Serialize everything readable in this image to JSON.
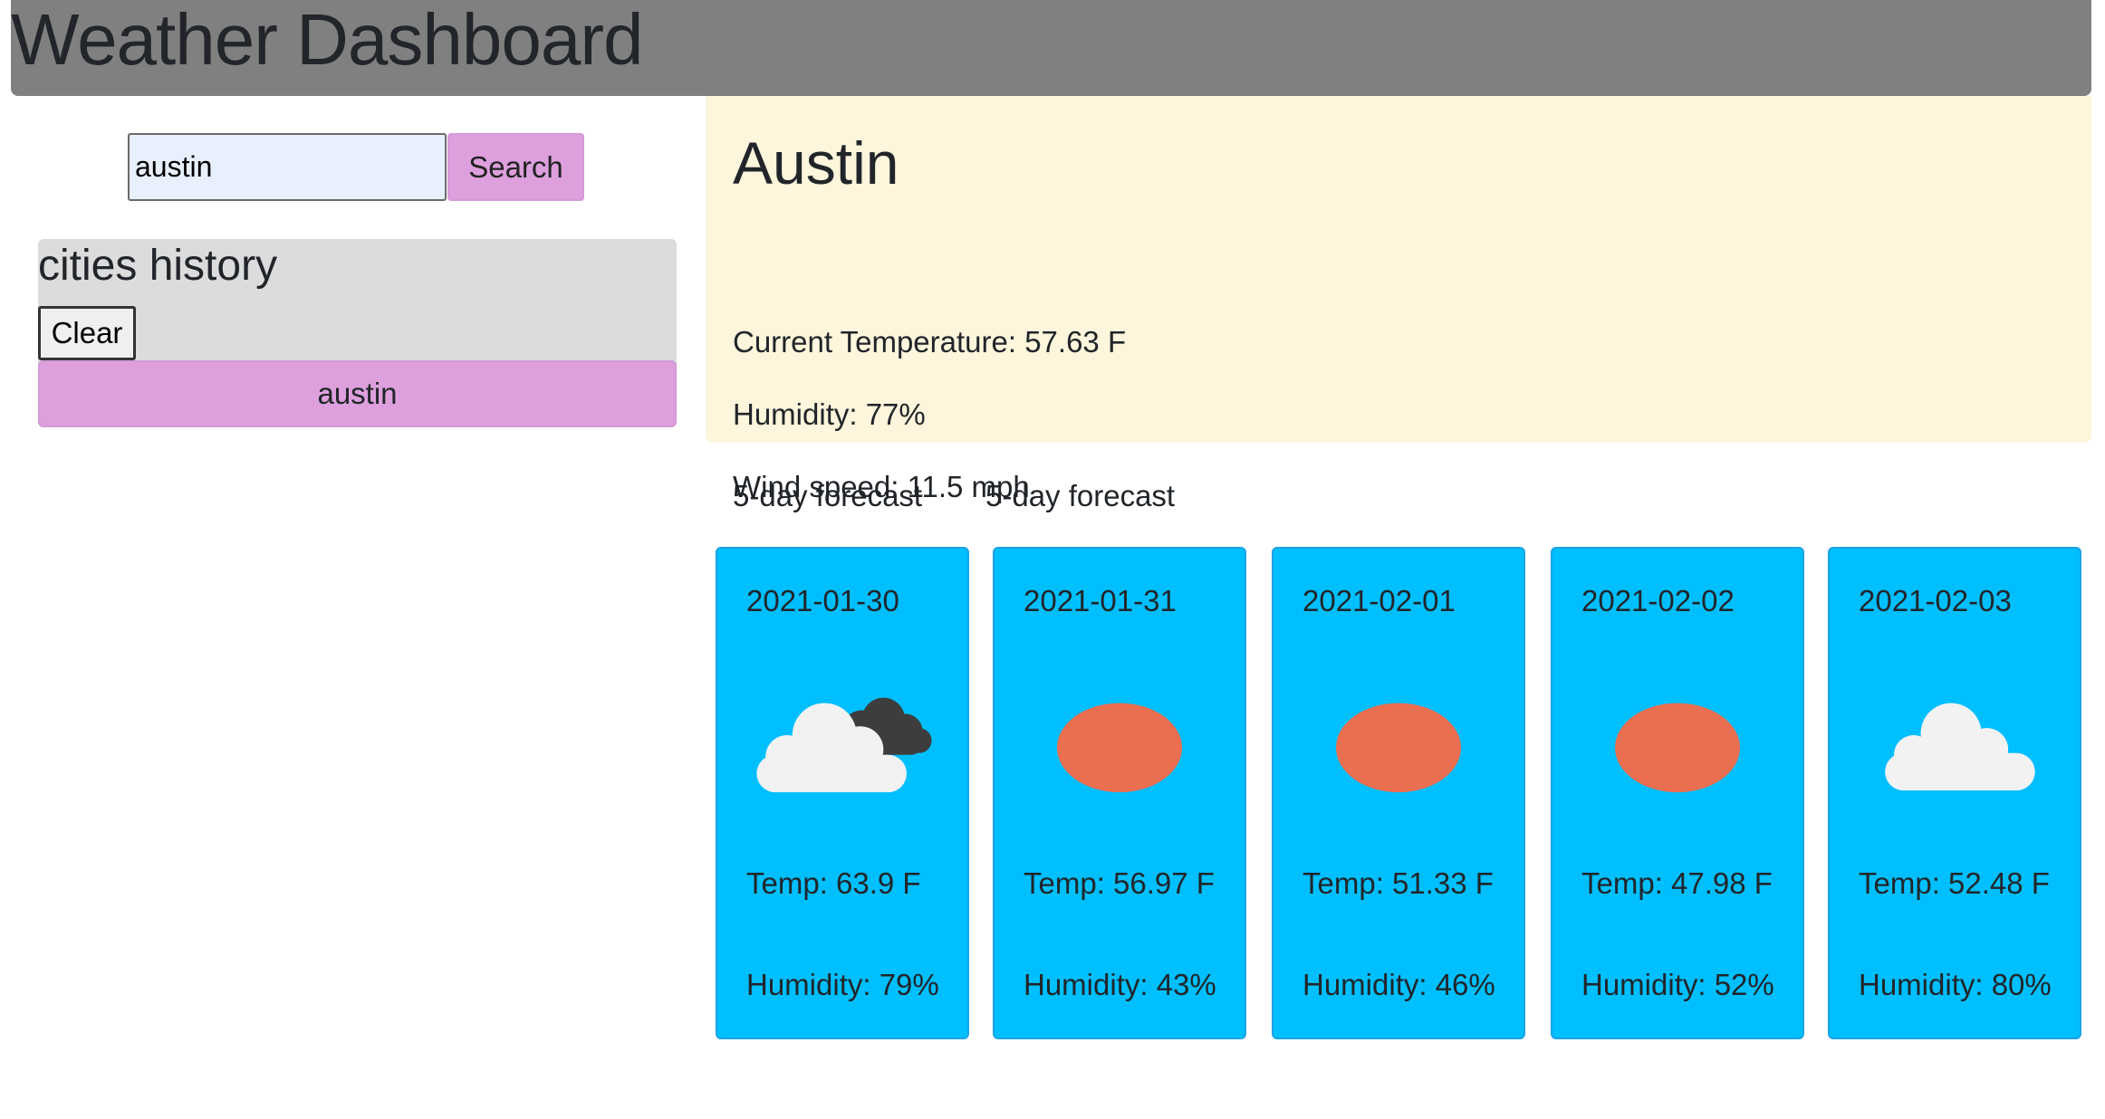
{
  "header": {
    "title": "Weather Dashboard"
  },
  "search": {
    "value": "austin",
    "button_label": "Search"
  },
  "history": {
    "title": "cities history",
    "clear_label": "Clear",
    "items": [
      {
        "label": "austin"
      }
    ]
  },
  "current": {
    "city": "Austin",
    "temperature": "Current Temperature: 57.63 F",
    "humidity": "Humidity: 77%",
    "wind": "Wind speed: 11.5 mph"
  },
  "forecast": {
    "headings": [
      "5-day forecast",
      "5-day forecast"
    ],
    "days": [
      {
        "date": "2021-01-30",
        "icon": "partly-cloudy-icon",
        "temp": "Temp: 63.9 F",
        "humidity": "Humidity: 79%"
      },
      {
        "date": "2021-01-31",
        "icon": "sun-icon",
        "temp": "Temp: 56.97 F",
        "humidity": "Humidity: 43%"
      },
      {
        "date": "2021-02-01",
        "icon": "sun-icon",
        "temp": "Temp: 51.33 F",
        "humidity": "Humidity: 46%"
      },
      {
        "date": "2021-02-02",
        "icon": "sun-icon",
        "temp": "Temp: 47.98 F",
        "humidity": "Humidity: 52%"
      },
      {
        "date": "2021-02-03",
        "icon": "cloud-icon",
        "temp": "Temp: 52.48 F",
        "humidity": "Humidity: 80%"
      }
    ]
  },
  "colors": {
    "header_bg": "#808080",
    "accent_purple": "#dda0dd",
    "current_bg": "#fdf5dc",
    "card_bg": "#00bfff",
    "sun": "#ea6e50",
    "history_bg": "#dcdcdc"
  }
}
